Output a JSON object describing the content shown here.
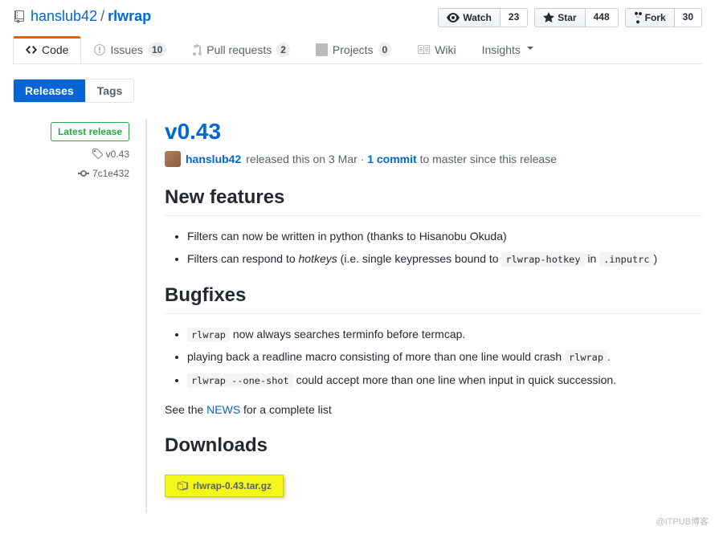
{
  "repo": {
    "owner": "hanslub42",
    "name": "rlwrap",
    "separator": "/"
  },
  "actions": {
    "watch": {
      "label": "Watch",
      "count": "23"
    },
    "star": {
      "label": "Star",
      "count": "448"
    },
    "fork": {
      "label": "Fork",
      "count": "30"
    }
  },
  "nav": {
    "code": "Code",
    "issues": {
      "label": "Issues",
      "count": "10"
    },
    "pulls": {
      "label": "Pull requests",
      "count": "2"
    },
    "projects": {
      "label": "Projects",
      "count": "0"
    },
    "wiki": "Wiki",
    "insights": "Insights"
  },
  "subnav": {
    "releases": "Releases",
    "tags": "Tags"
  },
  "release": {
    "badge": "Latest release",
    "tag": "v0.43",
    "commit": "7c1e432",
    "title": "v0.43",
    "author": "hanslub42",
    "released_prefix": " released this on 3 Mar · ",
    "commits_link": "1 commit",
    "commits_suffix": " to master since this release",
    "h_new": "New features",
    "li1_prefix": "Filters can now be written in python (thanks to Hisanobu Okuda)",
    "li2_a": "Filters can respond to ",
    "li2_em": "hotkeys",
    "li2_b": " (i.e. single keypresses bound to ",
    "li2_code1": "rlwrap-hotkey",
    "li2_c": " in ",
    "li2_code2": ".inputrc",
    "li2_d": ")",
    "h_bug": "Bugfixes",
    "li3_code": "rlwrap",
    "li3_txt": " now always searches terminfo before termcap.",
    "li4_a": "playing back a readline macro consisting of more than one line would crash ",
    "li4_code": "rlwrap",
    "li4_b": ".",
    "li5_code": "rlwrap --one-shot",
    "li5_txt": " could accept more than one line when input in quick succession.",
    "see_a": "See the ",
    "see_link": "NEWS",
    "see_b": " for a complete list",
    "h_dl": "Downloads",
    "dl_file": "rlwrap-0.43.tar.gz"
  },
  "watermark": "@ITPUB博客"
}
